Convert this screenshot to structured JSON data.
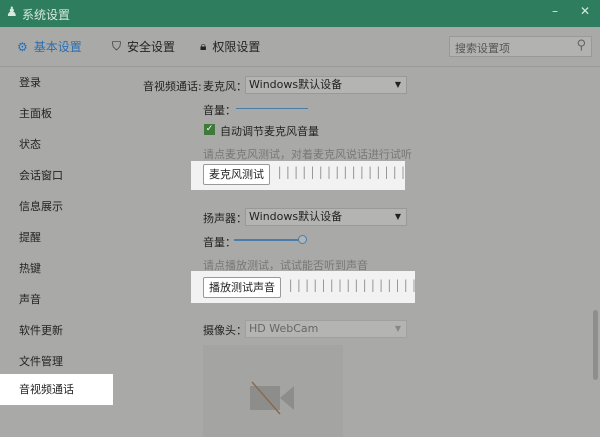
{
  "window": {
    "title": "系统设置",
    "minimize": "–",
    "close": "✕"
  },
  "toolbar": {
    "tabs": [
      "基本设置",
      "安全设置",
      "权限设置"
    ],
    "search_placeholder": "搜索设置项"
  },
  "sidebar": {
    "items": [
      "登录",
      "主面板",
      "状态",
      "会话窗口",
      "信息展示",
      "提醒",
      "热键",
      "声音",
      "软件更新",
      "文件管理",
      "音视频通话"
    ],
    "selected": 10
  },
  "av": {
    "section_label": "音视频通话:",
    "mic": {
      "label": "麦克风：",
      "device": "Windows默认设备",
      "volume_label": "音量：",
      "auto_adjust": "自动调节麦克风音量",
      "auto_adjust_checked": true,
      "hint": "请点麦克风测试，对着麦克风说话进行试听",
      "test_button": "麦克风测试"
    },
    "speaker": {
      "label": "扬声器：",
      "device": "Windows默认设备",
      "volume_label": "音量：",
      "volume": 0.95,
      "hint": "请点播放测试，试试能否听到声音",
      "test_button": "播放测试声音"
    },
    "camera": {
      "label": "摄像头：",
      "device": "HD WebCam"
    }
  },
  "colors": {
    "titlebar": "#2f7d5f",
    "accent": "#2a6fb0"
  }
}
